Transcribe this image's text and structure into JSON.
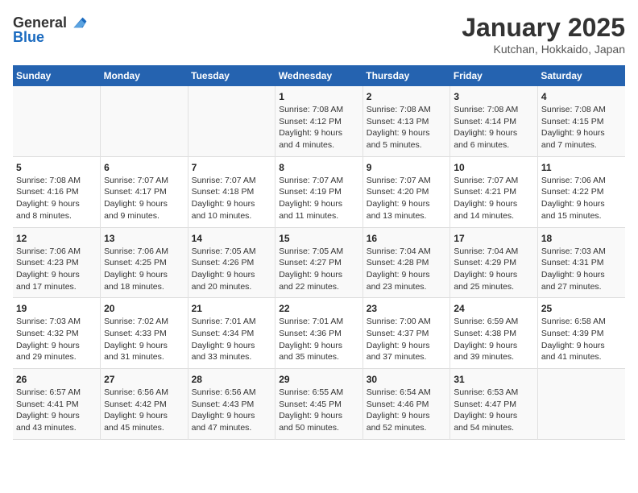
{
  "header": {
    "logo_general": "General",
    "logo_blue": "Blue",
    "month_year": "January 2025",
    "location": "Kutchan, Hokkaido, Japan"
  },
  "weekdays": [
    "Sunday",
    "Monday",
    "Tuesday",
    "Wednesday",
    "Thursday",
    "Friday",
    "Saturday"
  ],
  "weeks": [
    [
      {
        "day": "",
        "detail": ""
      },
      {
        "day": "",
        "detail": ""
      },
      {
        "day": "",
        "detail": ""
      },
      {
        "day": "1",
        "detail": "Sunrise: 7:08 AM\nSunset: 4:12 PM\nDaylight: 9 hours\nand 4 minutes."
      },
      {
        "day": "2",
        "detail": "Sunrise: 7:08 AM\nSunset: 4:13 PM\nDaylight: 9 hours\nand 5 minutes."
      },
      {
        "day": "3",
        "detail": "Sunrise: 7:08 AM\nSunset: 4:14 PM\nDaylight: 9 hours\nand 6 minutes."
      },
      {
        "day": "4",
        "detail": "Sunrise: 7:08 AM\nSunset: 4:15 PM\nDaylight: 9 hours\nand 7 minutes."
      }
    ],
    [
      {
        "day": "5",
        "detail": "Sunrise: 7:08 AM\nSunset: 4:16 PM\nDaylight: 9 hours\nand 8 minutes."
      },
      {
        "day": "6",
        "detail": "Sunrise: 7:07 AM\nSunset: 4:17 PM\nDaylight: 9 hours\nand 9 minutes."
      },
      {
        "day": "7",
        "detail": "Sunrise: 7:07 AM\nSunset: 4:18 PM\nDaylight: 9 hours\nand 10 minutes."
      },
      {
        "day": "8",
        "detail": "Sunrise: 7:07 AM\nSunset: 4:19 PM\nDaylight: 9 hours\nand 11 minutes."
      },
      {
        "day": "9",
        "detail": "Sunrise: 7:07 AM\nSunset: 4:20 PM\nDaylight: 9 hours\nand 13 minutes."
      },
      {
        "day": "10",
        "detail": "Sunrise: 7:07 AM\nSunset: 4:21 PM\nDaylight: 9 hours\nand 14 minutes."
      },
      {
        "day": "11",
        "detail": "Sunrise: 7:06 AM\nSunset: 4:22 PM\nDaylight: 9 hours\nand 15 minutes."
      }
    ],
    [
      {
        "day": "12",
        "detail": "Sunrise: 7:06 AM\nSunset: 4:23 PM\nDaylight: 9 hours\nand 17 minutes."
      },
      {
        "day": "13",
        "detail": "Sunrise: 7:06 AM\nSunset: 4:25 PM\nDaylight: 9 hours\nand 18 minutes."
      },
      {
        "day": "14",
        "detail": "Sunrise: 7:05 AM\nSunset: 4:26 PM\nDaylight: 9 hours\nand 20 minutes."
      },
      {
        "day": "15",
        "detail": "Sunrise: 7:05 AM\nSunset: 4:27 PM\nDaylight: 9 hours\nand 22 minutes."
      },
      {
        "day": "16",
        "detail": "Sunrise: 7:04 AM\nSunset: 4:28 PM\nDaylight: 9 hours\nand 23 minutes."
      },
      {
        "day": "17",
        "detail": "Sunrise: 7:04 AM\nSunset: 4:29 PM\nDaylight: 9 hours\nand 25 minutes."
      },
      {
        "day": "18",
        "detail": "Sunrise: 7:03 AM\nSunset: 4:31 PM\nDaylight: 9 hours\nand 27 minutes."
      }
    ],
    [
      {
        "day": "19",
        "detail": "Sunrise: 7:03 AM\nSunset: 4:32 PM\nDaylight: 9 hours\nand 29 minutes."
      },
      {
        "day": "20",
        "detail": "Sunrise: 7:02 AM\nSunset: 4:33 PM\nDaylight: 9 hours\nand 31 minutes."
      },
      {
        "day": "21",
        "detail": "Sunrise: 7:01 AM\nSunset: 4:34 PM\nDaylight: 9 hours\nand 33 minutes."
      },
      {
        "day": "22",
        "detail": "Sunrise: 7:01 AM\nSunset: 4:36 PM\nDaylight: 9 hours\nand 35 minutes."
      },
      {
        "day": "23",
        "detail": "Sunrise: 7:00 AM\nSunset: 4:37 PM\nDaylight: 9 hours\nand 37 minutes."
      },
      {
        "day": "24",
        "detail": "Sunrise: 6:59 AM\nSunset: 4:38 PM\nDaylight: 9 hours\nand 39 minutes."
      },
      {
        "day": "25",
        "detail": "Sunrise: 6:58 AM\nSunset: 4:39 PM\nDaylight: 9 hours\nand 41 minutes."
      }
    ],
    [
      {
        "day": "26",
        "detail": "Sunrise: 6:57 AM\nSunset: 4:41 PM\nDaylight: 9 hours\nand 43 minutes."
      },
      {
        "day": "27",
        "detail": "Sunrise: 6:56 AM\nSunset: 4:42 PM\nDaylight: 9 hours\nand 45 minutes."
      },
      {
        "day": "28",
        "detail": "Sunrise: 6:56 AM\nSunset: 4:43 PM\nDaylight: 9 hours\nand 47 minutes."
      },
      {
        "day": "29",
        "detail": "Sunrise: 6:55 AM\nSunset: 4:45 PM\nDaylight: 9 hours\nand 50 minutes."
      },
      {
        "day": "30",
        "detail": "Sunrise: 6:54 AM\nSunset: 4:46 PM\nDaylight: 9 hours\nand 52 minutes."
      },
      {
        "day": "31",
        "detail": "Sunrise: 6:53 AM\nSunset: 4:47 PM\nDaylight: 9 hours\nand 54 minutes."
      },
      {
        "day": "",
        "detail": ""
      }
    ]
  ]
}
